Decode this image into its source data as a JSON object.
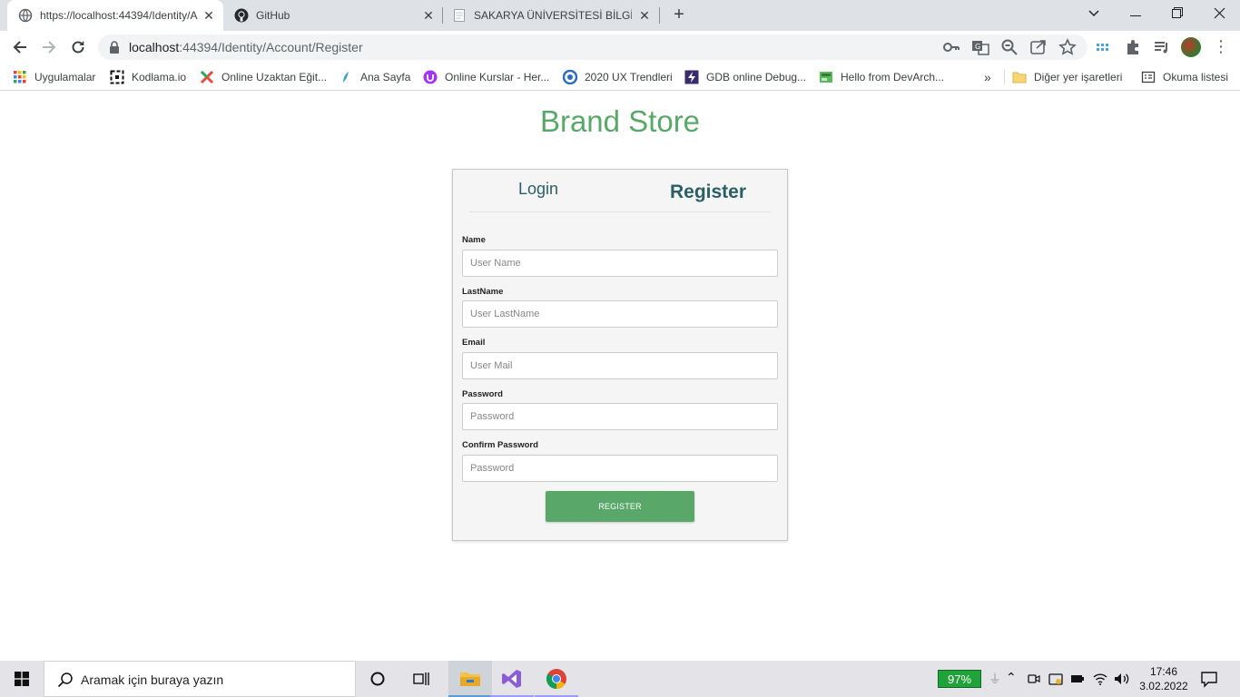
{
  "browser": {
    "tabs": [
      {
        "title": "https://localhost:44394/Identity/A",
        "active": true
      },
      {
        "title": "GitHub",
        "active": false
      },
      {
        "title": "SAKARYA ÜNİVERSİTESİ BİLGİ SİS",
        "active": false
      }
    ],
    "new_tab_label": "+",
    "address": {
      "host": "localhost",
      "path": ":44394/Identity/Account/Register"
    },
    "bookmarks": [
      {
        "label": "Uygulamalar",
        "icon": "apps-grid-icon"
      },
      {
        "label": "Kodlama.io",
        "icon": "kodlama-icon"
      },
      {
        "label": "Online Uzaktan Eğit...",
        "icon": "x-logo-icon"
      },
      {
        "label": "Ana Sayfa",
        "icon": "leaf-icon"
      },
      {
        "label": "Online Kurslar - Her...",
        "icon": "udemy-icon"
      },
      {
        "label": "2020 UX Trendleri",
        "icon": "circle-logo-icon"
      },
      {
        "label": "GDB online Debug...",
        "icon": "gdb-icon"
      },
      {
        "label": "Hello from DevArch...",
        "icon": "devarch-icon"
      },
      {
        "label": "Diğer yer işaretleri",
        "icon": "folder-icon"
      },
      {
        "label": "Okuma listesi",
        "icon": "reading-list-icon"
      }
    ],
    "overflow_label": "»"
  },
  "page": {
    "brand": "Brand Store",
    "tabs": {
      "login": "Login",
      "register": "Register"
    },
    "form": {
      "fields": [
        {
          "label": "Name",
          "placeholder": "User Name"
        },
        {
          "label": "LastName",
          "placeholder": "User LastName"
        },
        {
          "label": "Email",
          "placeholder": "User Mail"
        },
        {
          "label": "Password",
          "placeholder": "Password"
        },
        {
          "label": "Confirm Password",
          "placeholder": "Password"
        }
      ],
      "submit_label": "REGISTER"
    },
    "colors": {
      "brand_green": "#5aa869",
      "tab_text": "#2b5f66"
    }
  },
  "taskbar": {
    "search_placeholder": "Aramak için buraya yazın",
    "battery": "97%",
    "time": "17:46",
    "date": "3.02.2022"
  }
}
